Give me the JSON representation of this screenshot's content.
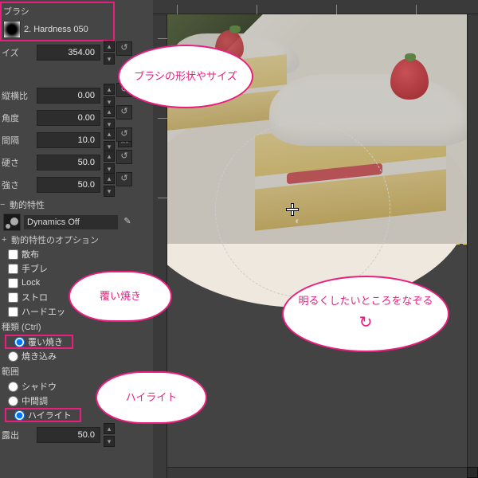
{
  "brush": {
    "section_label": "ブラシ",
    "name": "2. Hardness 050"
  },
  "size": {
    "label": "イズ",
    "value": "354.00"
  },
  "aspect": {
    "label": "縦横比",
    "value": "0.00"
  },
  "angle": {
    "label": "角度",
    "value": "0.00"
  },
  "spacing": {
    "label": "間隔",
    "value": "10.0"
  },
  "hardness": {
    "label": "硬さ",
    "value": "50.0"
  },
  "force": {
    "label": "強さ",
    "value": "50.0"
  },
  "dynamics": {
    "section": "動的特性",
    "value": "Dynamics Off",
    "options_label": "動的特性のオプション"
  },
  "checkboxes": {
    "scatter": "散布",
    "jitter": "手ブレ",
    "lock": "Lock",
    "stroke": "ストロ",
    "hard_edge": "ハードエッ"
  },
  "type": {
    "label": "種類 (Ctrl)",
    "dodge": "覆い焼き",
    "burn": "焼き込み"
  },
  "range": {
    "label": "範囲",
    "shadows": "シャドウ",
    "midtones": "中間調",
    "highlights": "ハイライト"
  },
  "exposure": {
    "label": "露出",
    "value": "50.0"
  },
  "callouts": {
    "brush_shape": "ブラシの形状やサイズ",
    "dodge": "覆い焼き",
    "highlights": "ハイライト",
    "trace": "明るくしたいところをなぞる"
  },
  "icons": {
    "reset": "↺",
    "link": "⛓",
    "pencil": "✎",
    "dodge_tool": "◐",
    "arrow_up": "▴",
    "arrow_dn": "▾"
  }
}
